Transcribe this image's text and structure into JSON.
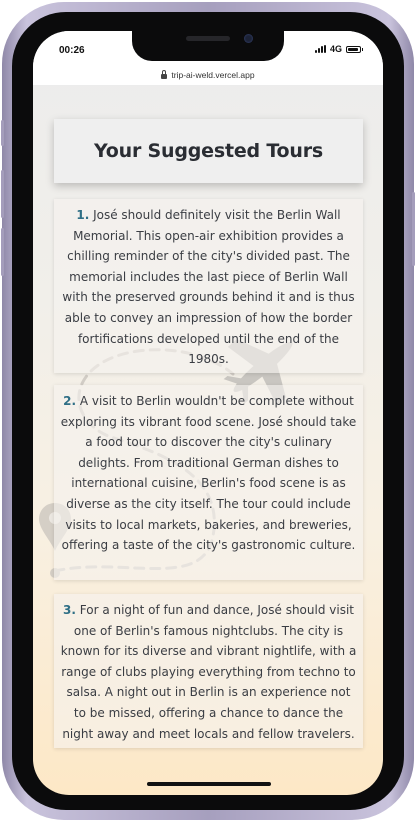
{
  "status_bar": {
    "time": "00:26",
    "network": "4G"
  },
  "browser": {
    "url": "trip-ai-weld.vercel.app"
  },
  "page": {
    "title": "Your Suggested Tours",
    "tours": [
      {
        "number": "1.",
        "text": "José should definitely visit the Berlin Wall Memorial. This open-air exhibition provides a chilling reminder of the city's divided past. The memorial includes the last piece of Berlin Wall with the preserved grounds behind it and is thus able to convey an impression of how the border fortifications developed until the end of the 1980s."
      },
      {
        "number": "2.",
        "text": "A visit to Berlin wouldn't be complete without exploring its vibrant food scene. José should take a food tour to discover the city's culinary delights. From traditional German dishes to international cuisine, Berlin's food scene is as diverse as the city itself. The tour could include visits to local markets, bakeries, and breweries, offering a taste of the city's gastronomic culture."
      },
      {
        "number": "3.",
        "text": "For a night of fun and dance, José should visit one of Berlin's famous nightclubs. The city is known for its diverse and vibrant nightlife, with a range of clubs playing everything from techno to salsa. A night out in Berlin is an experience not to be missed, offering a chance to dance the night away and meet locals and fellow travelers."
      }
    ]
  },
  "decor": {
    "icons": [
      "airplane-icon",
      "map-pin-icon"
    ],
    "accent_color": "#2f6f86"
  }
}
